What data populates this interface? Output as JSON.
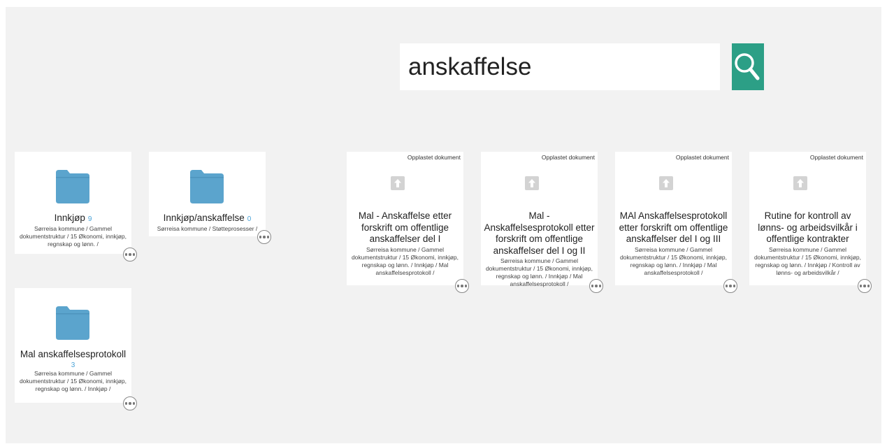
{
  "search": {
    "value": "anskaffelse",
    "button_icon": "search-icon",
    "accent_color": "#2c9f86"
  },
  "folders": [
    {
      "title": "Innkjøp",
      "count": "9",
      "path": "Sørreisa kommune / Gammel dokumentstruktur / 15 Økonomi, innkjøp, regnskap og lønn. /"
    },
    {
      "title": "Innkjøp/anskaffelse",
      "count": "0",
      "path": "Sørreisa kommune / Støtteprosesser /"
    },
    {
      "title": "Mal anskaffelsesprotokoll",
      "count": "3",
      "path": "Sørreisa kommune / Gammel dokumentstruktur / 15 Økonomi, innkjøp, regnskap og lønn. / Innkjøp /"
    }
  ],
  "documents": [
    {
      "label": "Opplastet dokument",
      "title": "Mal - Anskaffelse etter forskrift om offentlige anskaffelser del I",
      "path": "Sørreisa kommune / Gammel dokumentstruktur / 15 Økonomi, innkjøp, regnskap og lønn. / Innkjøp / Mal anskaffelsesprotokoll /"
    },
    {
      "label": "Opplastet dokument",
      "title": "Mal - Anskaffelsesprotokoll etter forskrift om offentlige anskaffelser del I og II",
      "path": "Sørreisa kommune / Gammel dokumentstruktur / 15 Økonomi, innkjøp, regnskap og lønn. / Innkjøp / Mal anskaffelsesprotokoll /"
    },
    {
      "label": "Opplastet dokument",
      "title": "MAl Anskaffelsesprotokoll etter forskrift om offentlige anskaffelser del I og III",
      "path": "Sørreisa kommune / Gammel dokumentstruktur / 15 Økonomi, innkjøp, regnskap og lønn. / Innkjøp / Mal anskaffelsesprotokoll /"
    },
    {
      "label": "Opplastet dokument",
      "title": "Rutine for kontroll av lønns- og arbeidsvilkår i offentlige kontrakter",
      "path": "Sørreisa kommune / Gammel dokumentstruktur / 15 Økonomi, innkjøp, regnskap og lønn. / Innkjøp / Kontroll av lønns- og arbeidsvilkår /"
    }
  ],
  "icons": {
    "folder": "folder-icon",
    "upload": "upload-icon",
    "more": "more-options-icon"
  },
  "colors": {
    "folder": "#5ba4cd",
    "count": "#4aa3d8",
    "background": "#f2f2f2"
  }
}
